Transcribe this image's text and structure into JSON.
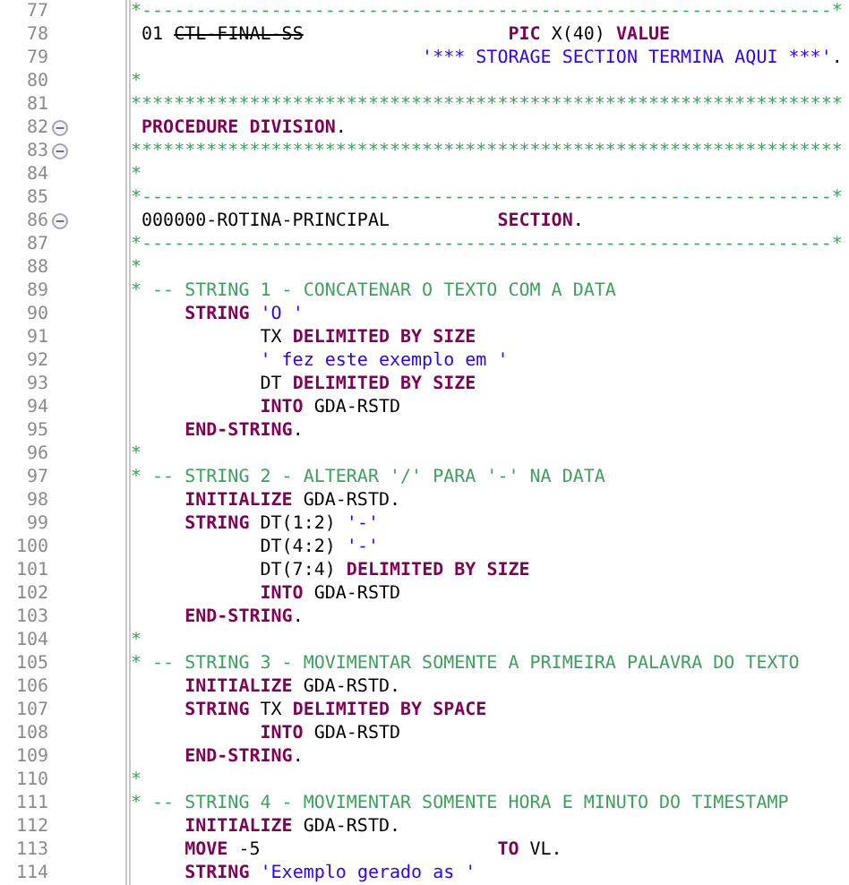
{
  "editor": {
    "lines": [
      {
        "number": "77",
        "segments": [
          {
            "kind": "comment",
            "text": "*----------------------------------------------------------------*"
          }
        ]
      },
      {
        "number": "78",
        "segments": [
          {
            "kind": "plain",
            "text": " 01 "
          },
          {
            "kind": "strike",
            "text": "CTL-FINAL-SS"
          },
          {
            "kind": "keyword",
            "text": "                   PIC"
          },
          {
            "kind": "plain",
            "text": " X(40) "
          },
          {
            "kind": "keyword",
            "text": "VALUE"
          }
        ]
      },
      {
        "number": "79",
        "segments": [
          {
            "kind": "string",
            "text": "                           '*** STORAGE SECTION TERMINA AQUI ***'"
          },
          {
            "kind": "plain",
            "text": "."
          }
        ]
      },
      {
        "number": "80",
        "segments": [
          {
            "kind": "comment",
            "text": "*"
          }
        ]
      },
      {
        "number": "81",
        "segments": [
          {
            "kind": "comment",
            "text": "******************************************************************"
          }
        ]
      },
      {
        "number": "82",
        "expanded": true,
        "segments": [
          {
            "kind": "keyword",
            "text": " PROCEDURE DIVISION"
          },
          {
            "kind": "plain",
            "text": "."
          }
        ]
      },
      {
        "number": "83",
        "expanded": true,
        "segments": [
          {
            "kind": "comment",
            "text": "******************************************************************"
          }
        ]
      },
      {
        "number": "84",
        "segments": [
          {
            "kind": "comment",
            "text": "*"
          }
        ]
      },
      {
        "number": "85",
        "segments": [
          {
            "kind": "comment",
            "text": "*----------------------------------------------------------------*"
          }
        ]
      },
      {
        "number": "86",
        "expanded": true,
        "segments": [
          {
            "kind": "plain",
            "text": " 000000-ROTINA-PRINCIPAL          "
          },
          {
            "kind": "keyword",
            "text": "SECTION"
          },
          {
            "kind": "plain",
            "text": "."
          }
        ]
      },
      {
        "number": "87",
        "segments": [
          {
            "kind": "comment",
            "text": "*----------------------------------------------------------------*"
          }
        ]
      },
      {
        "number": "88",
        "segments": [
          {
            "kind": "comment",
            "text": "*"
          }
        ]
      },
      {
        "number": "89",
        "segments": [
          {
            "kind": "comment",
            "text": "* -- STRING 1 - CONCATENAR O TEXTO COM A DATA"
          }
        ]
      },
      {
        "number": "90",
        "segments": [
          {
            "kind": "keyword",
            "text": "     STRING"
          },
          {
            "kind": "string",
            "text": " 'O '"
          }
        ]
      },
      {
        "number": "91",
        "segments": [
          {
            "kind": "plain",
            "text": "            TX "
          },
          {
            "kind": "keyword",
            "text": "DELIMITED BY SIZE"
          }
        ]
      },
      {
        "number": "92",
        "segments": [
          {
            "kind": "string",
            "text": "            ' fez este exemplo em '"
          }
        ]
      },
      {
        "number": "93",
        "segments": [
          {
            "kind": "plain",
            "text": "            DT "
          },
          {
            "kind": "keyword",
            "text": "DELIMITED BY SIZE"
          }
        ]
      },
      {
        "number": "94",
        "segments": [
          {
            "kind": "keyword",
            "text": "            INTO"
          },
          {
            "kind": "plain",
            "text": " GDA-RSTD"
          }
        ]
      },
      {
        "number": "95",
        "segments": [
          {
            "kind": "keyword",
            "text": "     END-STRING"
          },
          {
            "kind": "plain",
            "text": "."
          }
        ]
      },
      {
        "number": "96",
        "segments": [
          {
            "kind": "comment",
            "text": "*"
          }
        ]
      },
      {
        "number": "97",
        "segments": [
          {
            "kind": "comment",
            "text": "* -- STRING 2 - ALTERAR '/' PARA '-' NA DATA"
          }
        ]
      },
      {
        "number": "98",
        "segments": [
          {
            "kind": "keyword",
            "text": "     INITIALIZE"
          },
          {
            "kind": "plain",
            "text": " GDA-RSTD."
          }
        ]
      },
      {
        "number": "99",
        "segments": [
          {
            "kind": "keyword",
            "text": "     STRING"
          },
          {
            "kind": "plain",
            "text": " DT(1:2) "
          },
          {
            "kind": "string",
            "text": "'-'"
          }
        ]
      },
      {
        "number": "100",
        "segments": [
          {
            "kind": "plain",
            "text": "            DT(4:2) "
          },
          {
            "kind": "string",
            "text": "'-'"
          }
        ]
      },
      {
        "number": "101",
        "segments": [
          {
            "kind": "plain",
            "text": "            DT(7:4) "
          },
          {
            "kind": "keyword",
            "text": "DELIMITED BY SIZE"
          }
        ]
      },
      {
        "number": "102",
        "segments": [
          {
            "kind": "keyword",
            "text": "            INTO"
          },
          {
            "kind": "plain",
            "text": " GDA-RSTD"
          }
        ]
      },
      {
        "number": "103",
        "segments": [
          {
            "kind": "keyword",
            "text": "     END-STRING"
          },
          {
            "kind": "plain",
            "text": "."
          }
        ]
      },
      {
        "number": "104",
        "segments": [
          {
            "kind": "comment",
            "text": "*"
          }
        ]
      },
      {
        "number": "105",
        "segments": [
          {
            "kind": "comment",
            "text": "* -- STRING 3 - MOVIMENTAR SOMENTE A PRIMEIRA PALAVRA DO TEXTO"
          }
        ]
      },
      {
        "number": "106",
        "segments": [
          {
            "kind": "keyword",
            "text": "     INITIALIZE"
          },
          {
            "kind": "plain",
            "text": " GDA-RSTD."
          }
        ]
      },
      {
        "number": "107",
        "segments": [
          {
            "kind": "keyword",
            "text": "     STRING"
          },
          {
            "kind": "plain",
            "text": " TX "
          },
          {
            "kind": "keyword",
            "text": "DELIMITED BY SPACE"
          }
        ]
      },
      {
        "number": "108",
        "segments": [
          {
            "kind": "keyword",
            "text": "            INTO"
          },
          {
            "kind": "plain",
            "text": " GDA-RSTD"
          }
        ]
      },
      {
        "number": "109",
        "segments": [
          {
            "kind": "keyword",
            "text": "     END-STRING"
          },
          {
            "kind": "plain",
            "text": "."
          }
        ]
      },
      {
        "number": "110",
        "segments": [
          {
            "kind": "comment",
            "text": "*"
          }
        ]
      },
      {
        "number": "111",
        "segments": [
          {
            "kind": "comment",
            "text": "* -- STRING 4 - MOVIMENTAR SOMENTE HORA E MINUTO DO TIMESTAMP"
          }
        ]
      },
      {
        "number": "112",
        "segments": [
          {
            "kind": "keyword",
            "text": "     INITIALIZE"
          },
          {
            "kind": "plain",
            "text": " GDA-RSTD."
          }
        ]
      },
      {
        "number": "113",
        "segments": [
          {
            "kind": "keyword",
            "text": "     MOVE"
          },
          {
            "kind": "plain",
            "text": " -5                      "
          },
          {
            "kind": "keyword",
            "text": "TO"
          },
          {
            "kind": "plain",
            "text": " VL."
          }
        ]
      },
      {
        "number": "114",
        "segments": [
          {
            "kind": "keyword",
            "text": "     STRING"
          },
          {
            "kind": "string",
            "text": " 'Exemplo gerado as '"
          }
        ]
      }
    ]
  }
}
